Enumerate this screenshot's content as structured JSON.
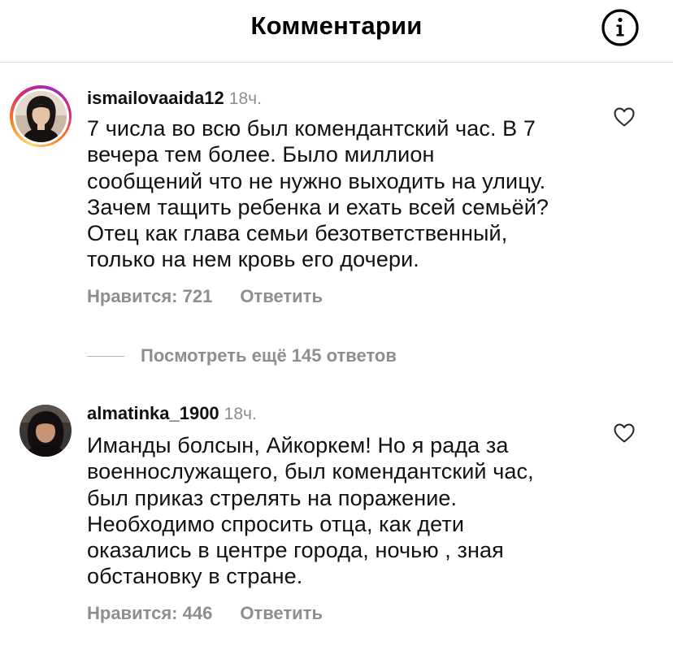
{
  "header": {
    "title": "Комментарии",
    "info_icon": "info-circle-icon"
  },
  "comments": [
    {
      "username": "ismailovaaida12",
      "time": "18ч.",
      "has_story_ring": true,
      "lines": [
        "7 числа во всю был комендантский час. В 7",
        "вечера тем более. Было миллион",
        "сообщений что не нужно выходить на улицу.",
        "Зачем тащить ребенка и ехать всей семьёй?",
        "Отец как глава семьи безответственный,",
        "только на нем кровь его дочери."
      ],
      "likes": "Нравится: 721",
      "reply": "Ответить",
      "like_icon": "heart-outline-icon"
    },
    {
      "username": "almatinka_1900",
      "time": "18ч.",
      "has_story_ring": false,
      "lines": [
        "Иманды болсын, Айкоркем! Но я рада за",
        "военнослужащего, был комендантский час,",
        "был приказ стрелять на поражение.",
        "Необходимо спросить отца, как дети",
        "оказались в центре города, ночью , зная",
        "обстановку в стране."
      ],
      "likes": "Нравится: 446",
      "reply": "Ответить",
      "like_icon": "heart-outline-icon"
    }
  ],
  "view_more": "Посмотреть ещё 145 ответов"
}
